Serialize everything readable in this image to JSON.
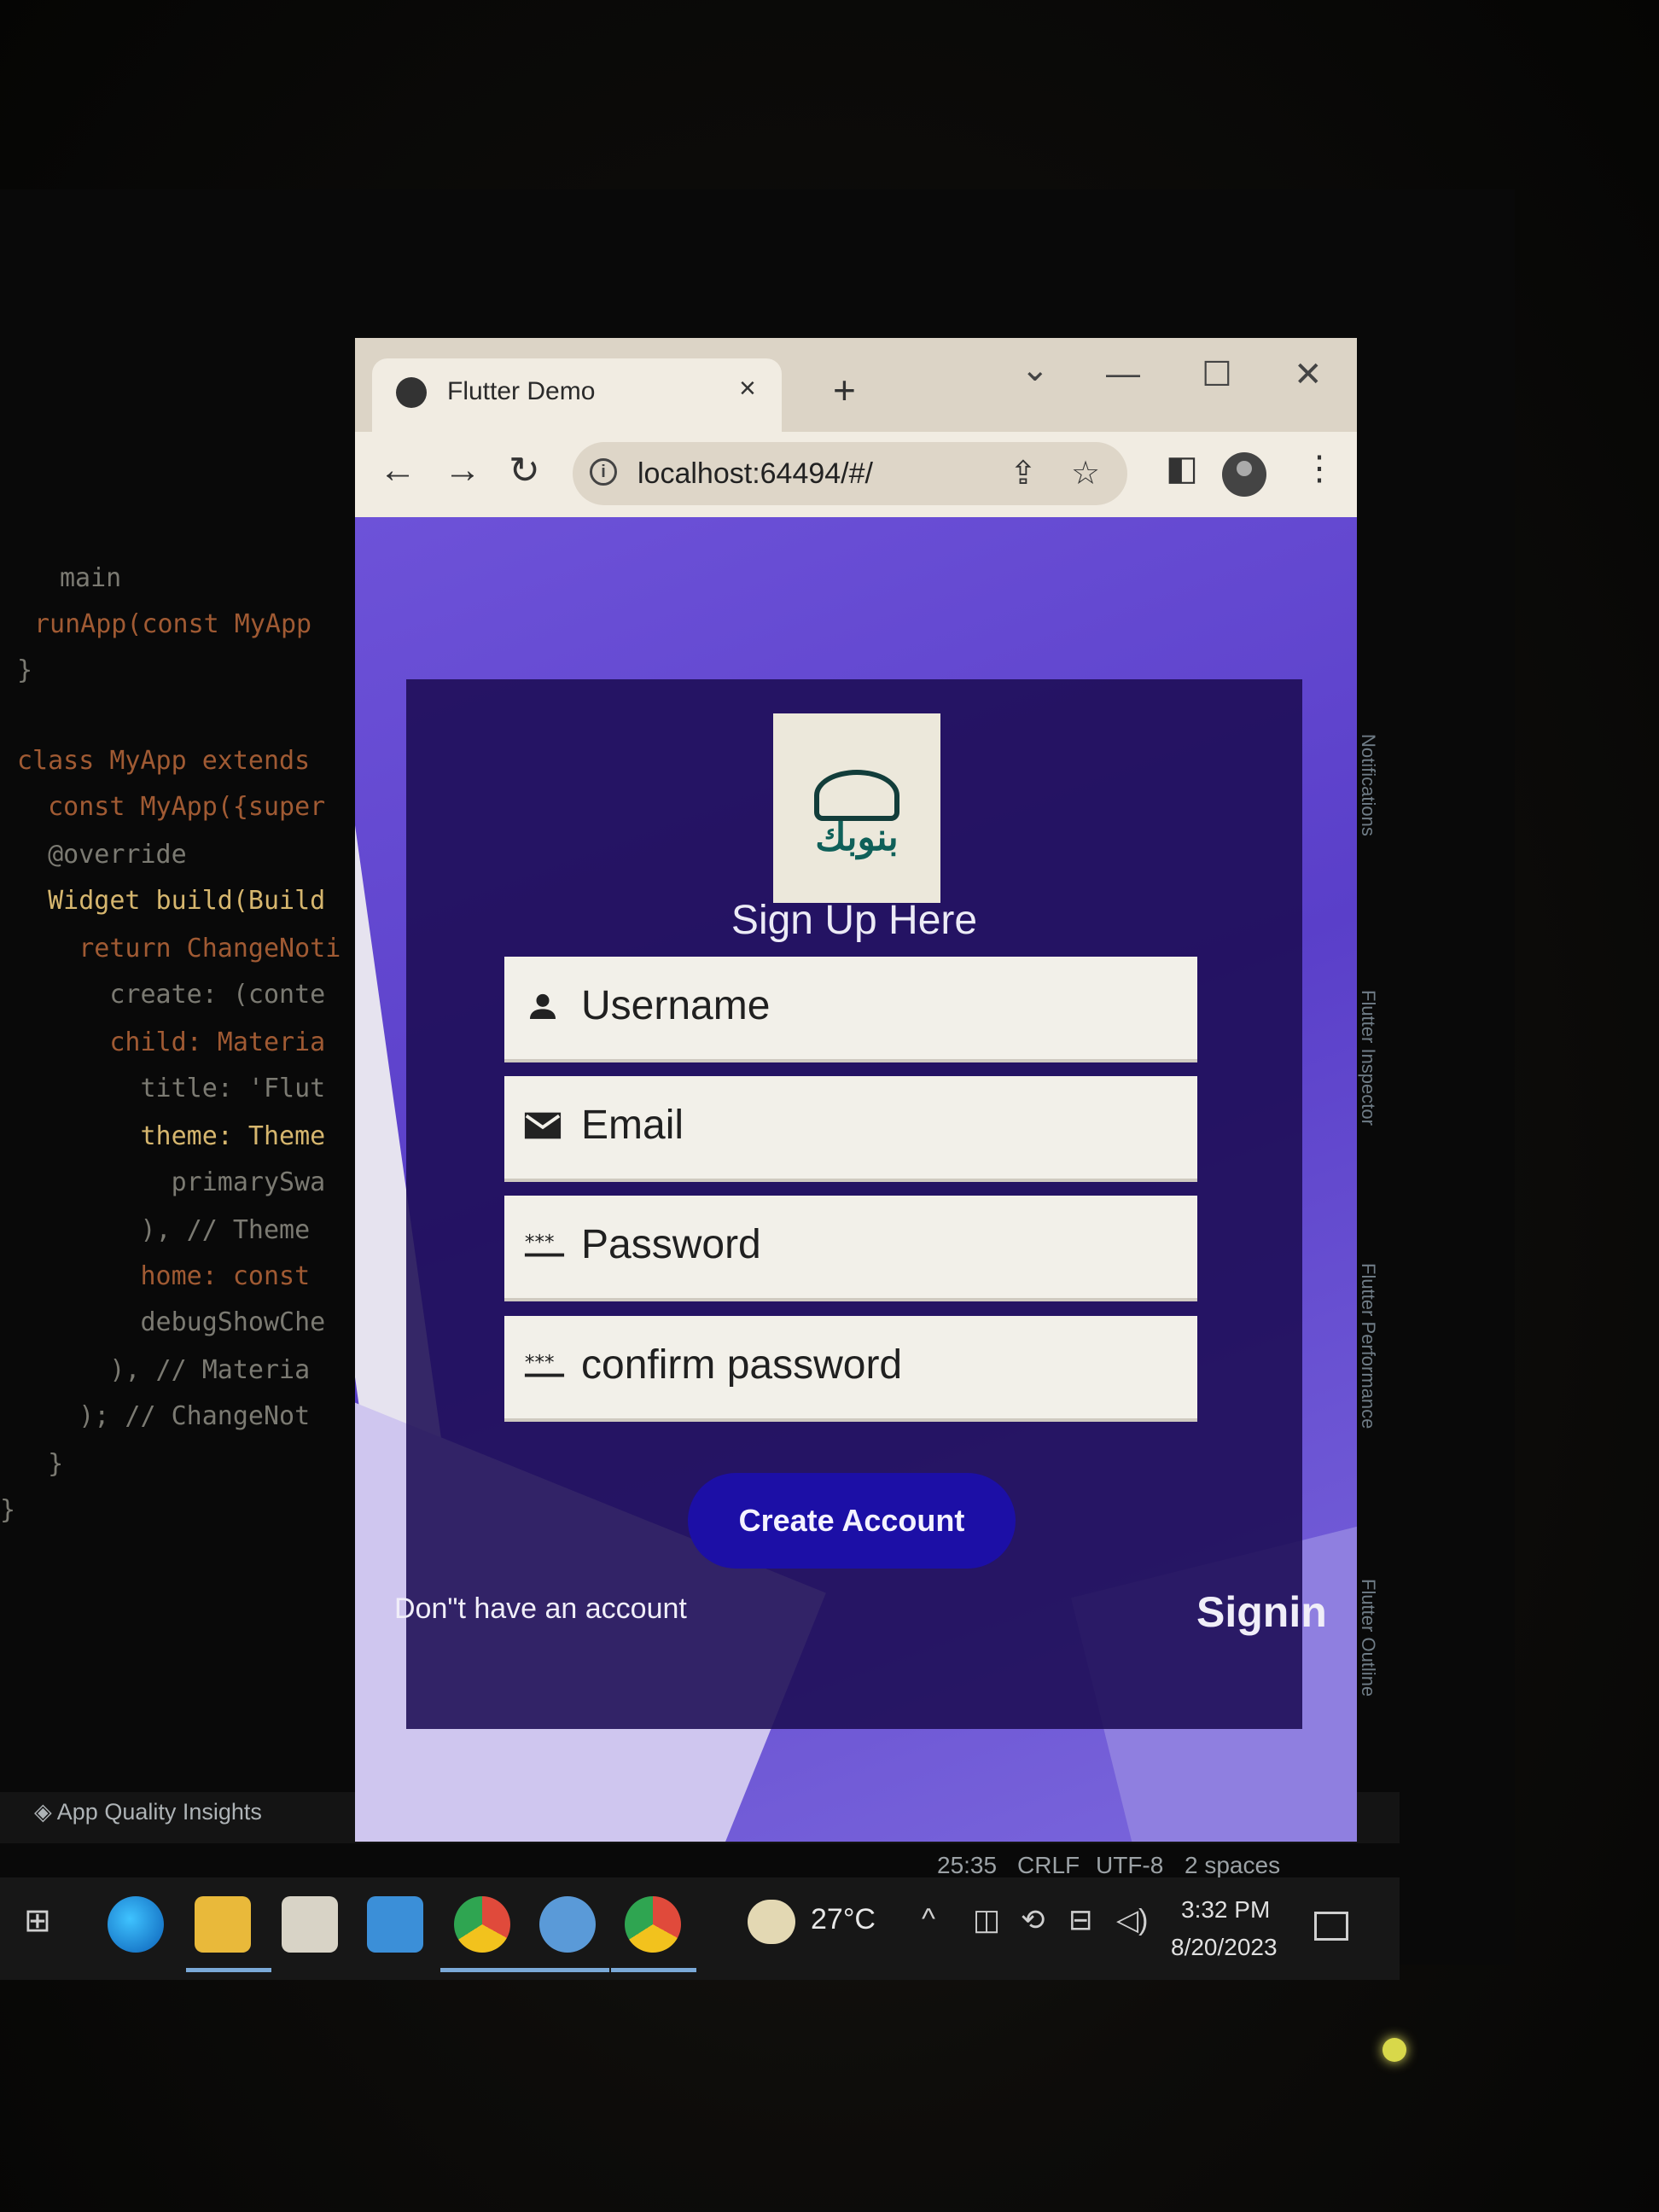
{
  "ide": {
    "code_lines": [
      "main",
      "runApp(const MyApp",
      "}",
      "class MyApp extends",
      "  const MyApp({super",
      "  @override",
      "  Widget build(Build",
      "    return ChangeNoti",
      "      create: (conte",
      "      child: Materia",
      "        title: 'Flut",
      "        theme: Theme",
      "          primarySwa",
      "        ), // Theme",
      "        home: const",
      "        debugShowChe",
      "      ), // Materia",
      "    ); // ChangeNot",
      "  }",
      "}"
    ],
    "side_panels": [
      "Notifications",
      "Flutter Inspector",
      "Flutter Performance",
      "Flutter Outline"
    ],
    "app_quality_label": "App Quality Insights",
    "status": {
      "position": "25:35",
      "line_ending": "CRLF",
      "encoding": "UTF-8",
      "indent": "2 spaces"
    }
  },
  "browser": {
    "tab_title": "Flutter Demo",
    "tab_close": "×",
    "new_tab": "+",
    "url": "localhost:64494/#/",
    "icons": {
      "back": "arrow-left",
      "forward": "arrow-right",
      "reload": "reload",
      "share": "share",
      "bookmark": "star",
      "side_panel": "side-panel",
      "profile": "profile",
      "menu": "kebab-menu"
    }
  },
  "signup": {
    "logo_text": "بنوبك",
    "title": "Sign Up Here",
    "fields": [
      {
        "icon": "person",
        "placeholder": "Username"
      },
      {
        "icon": "mail",
        "placeholder": "Email"
      },
      {
        "icon": "password",
        "placeholder": "Password"
      },
      {
        "icon": "password",
        "placeholder": "confirm password"
      }
    ],
    "create_button": "Create Account",
    "no_account_text": "Don\"t have an account",
    "signin_link": "Signin"
  },
  "taskbar": {
    "temperature": "27°C",
    "time": "3:32 PM",
    "date": "8/20/2023"
  }
}
